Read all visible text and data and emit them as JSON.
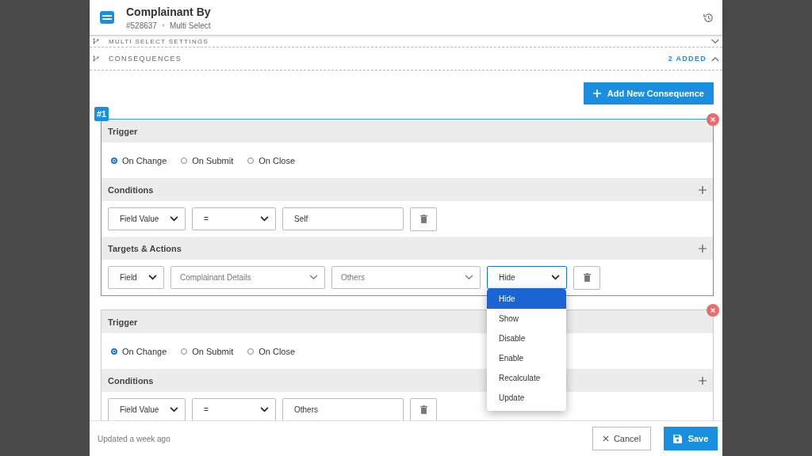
{
  "header": {
    "title": "Complainant By",
    "id": "#528637",
    "type": "Multi Select"
  },
  "sections": [
    {
      "label": "MULTI SELECT SETTINGS",
      "expanded": false
    },
    {
      "label": "CONSEQUENCES",
      "badge": "2 ADDED",
      "expanded": true
    }
  ],
  "add_button": "Add New Consequence",
  "consequences": [
    {
      "number": "#1",
      "active": true,
      "trigger_label": "Trigger",
      "triggers": [
        {
          "label": "On Change",
          "selected": true
        },
        {
          "label": "On Submit",
          "selected": false
        },
        {
          "label": "On Close",
          "selected": false
        }
      ],
      "conditions_label": "Conditions",
      "conditions": [
        {
          "field": "Field Value",
          "operator": "=",
          "value": "Self"
        }
      ],
      "targets_label": "Targets & Actions",
      "targets": [
        {
          "type": "Field",
          "field": "Complainant Details",
          "value": "Others",
          "action": "Hide",
          "dropdown_open": true,
          "options": [
            {
              "label": "Hide",
              "selected": true
            },
            {
              "label": "Show",
              "selected": false
            },
            {
              "label": "Disable",
              "selected": false
            },
            {
              "label": "Enable",
              "selected": false
            },
            {
              "label": "Recalculate",
              "selected": false
            },
            {
              "label": "Update",
              "selected": false
            }
          ]
        }
      ]
    },
    {
      "active": false,
      "trigger_label": "Trigger",
      "triggers": [
        {
          "label": "On Change",
          "selected": true
        },
        {
          "label": "On Submit",
          "selected": false
        },
        {
          "label": "On Close",
          "selected": false
        }
      ],
      "conditions_label": "Conditions",
      "conditions": [
        {
          "field": "Field Value",
          "operator": "=",
          "value": "Others"
        }
      ]
    }
  ],
  "footer": {
    "updated": "Updated a week ago",
    "cancel": "Cancel",
    "save": "Save"
  }
}
